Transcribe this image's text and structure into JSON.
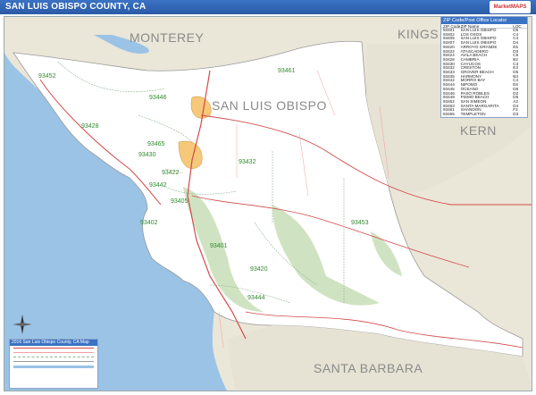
{
  "title": "SAN LUIS OBISPO COUNTY, CA",
  "logo_text": "MarketMAPS",
  "counties": {
    "monterey": "MONTEREY",
    "kings": "KINGS",
    "san_luis_obispo": "SAN LUIS OBISPO",
    "kern": "KERN",
    "santa_barbara": "SANTA BARBARA"
  },
  "zips": [
    "93452",
    "93461",
    "93446",
    "93428",
    "93465",
    "93430",
    "93422",
    "93432",
    "93442",
    "93405",
    "93402",
    "93453",
    "93401",
    "93420",
    "93444"
  ],
  "legend": {
    "header": "ZIP Code/Post Office Locator",
    "columns": [
      "ZIP Code",
      "ZIP Name",
      "LOC"
    ],
    "rows": [
      [
        "93401",
        "SAN LUIS OBISPO",
        "D5"
      ],
      [
        "93402",
        "LOS OSOS",
        "C4"
      ],
      [
        "93405",
        "SAN LUIS OBISPO",
        "C4"
      ],
      [
        "93407",
        "SAN LUIS OBISPO",
        "D4"
      ],
      [
        "93420",
        "ARROYO GRANDE",
        "E5"
      ],
      [
        "93422",
        "ATASCADERO",
        "D3"
      ],
      [
        "93424",
        "AVILA BEACH",
        "C5"
      ],
      [
        "93428",
        "CAMBRIA",
        "B2"
      ],
      [
        "93430",
        "CAYUCOS",
        "C3"
      ],
      [
        "93432",
        "CRESTON",
        "E3"
      ],
      [
        "93433",
        "GROVER BEACH",
        "D5"
      ],
      [
        "93435",
        "HARMONY",
        "B3"
      ],
      [
        "93442",
        "MORRO BAY",
        "C4"
      ],
      [
        "93444",
        "NIPOMO",
        "E6"
      ],
      [
        "93445",
        "OCEANO",
        "D6"
      ],
      [
        "93446",
        "PASO ROBLES",
        "D2"
      ],
      [
        "93449",
        "PISMO BEACH",
        "D5"
      ],
      [
        "93452",
        "SAN SIMEON",
        "A2"
      ],
      [
        "93453",
        "SANTA MARGARITA",
        "D4"
      ],
      [
        "93461",
        "SHANDON",
        "F2"
      ],
      [
        "93465",
        "TEMPLETON",
        "D3"
      ]
    ]
  },
  "key_title": "2016 San Luis Obispo County, CA Map"
}
